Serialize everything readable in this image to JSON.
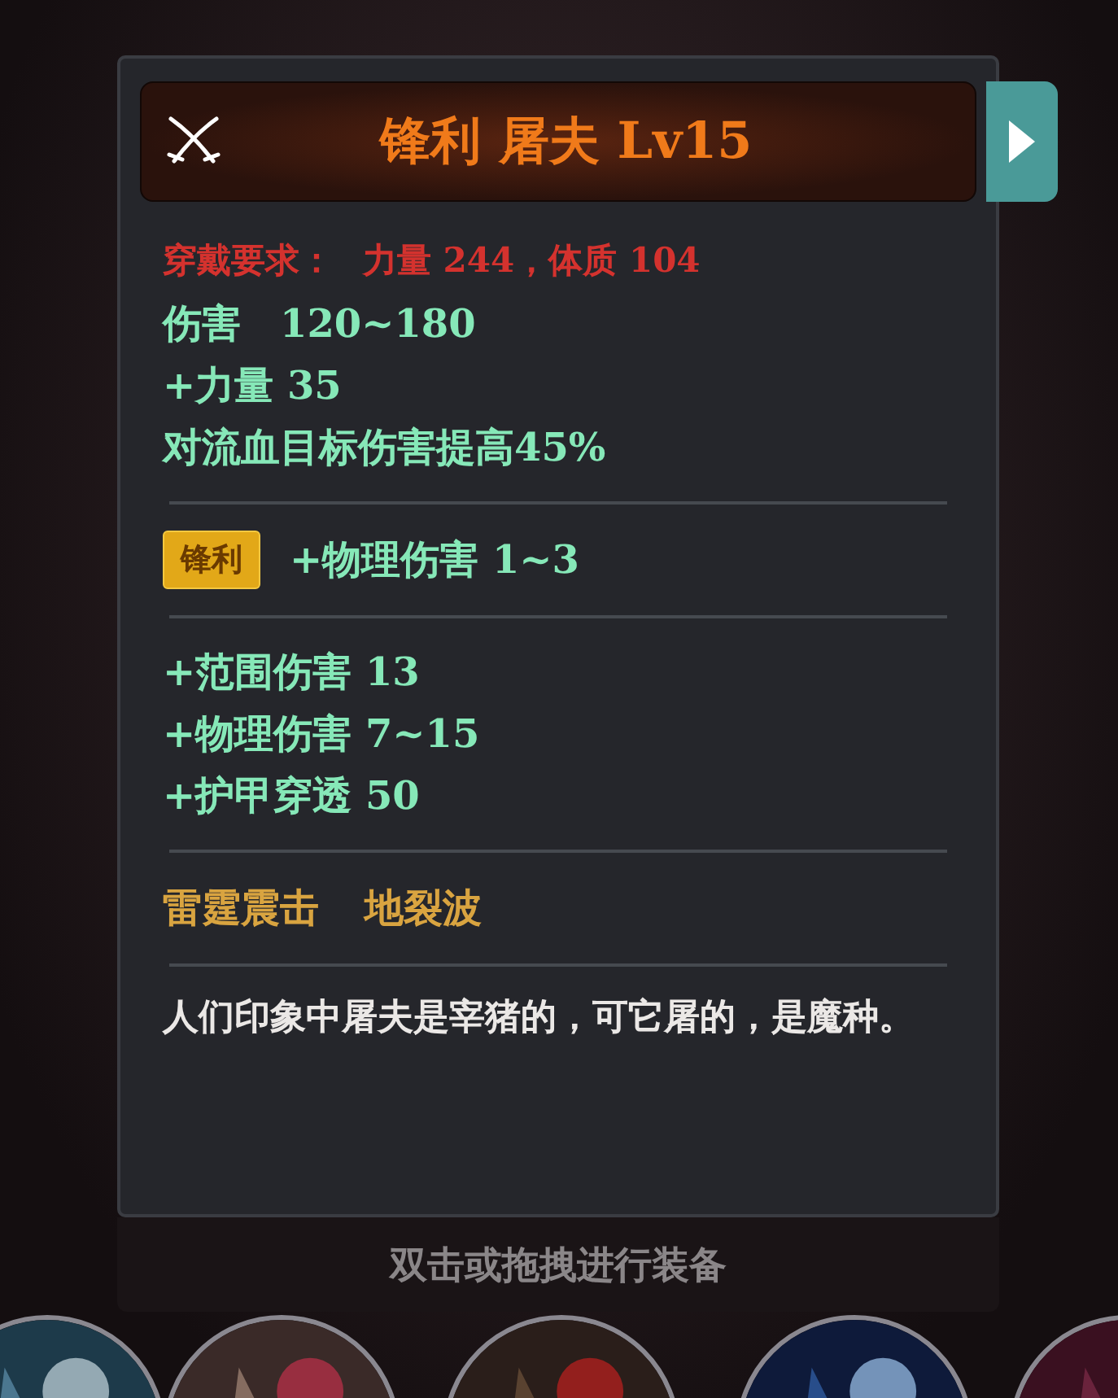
{
  "tooltip": {
    "title": "锋利 屠夫 Lv15",
    "requirement": {
      "label": "穿戴要求：",
      "value": "力量 244，体质 104"
    },
    "base_stats": [
      "伤害　120~180",
      "+力量 35",
      "对流血目标伤害提高45%"
    ],
    "affix": {
      "tag": "锋利",
      "text": "+物理伤害 1~3"
    },
    "bonus_stats": [
      "+范围伤害 13",
      "+物理伤害 7~15",
      "+护甲穿透 50"
    ],
    "skills": [
      "雷霆震击",
      "地裂波"
    ],
    "description": "人们印象中屠夫是宰猪的，可它屠的，是魔种。"
  },
  "hint": "双击或拖拽进行装备"
}
